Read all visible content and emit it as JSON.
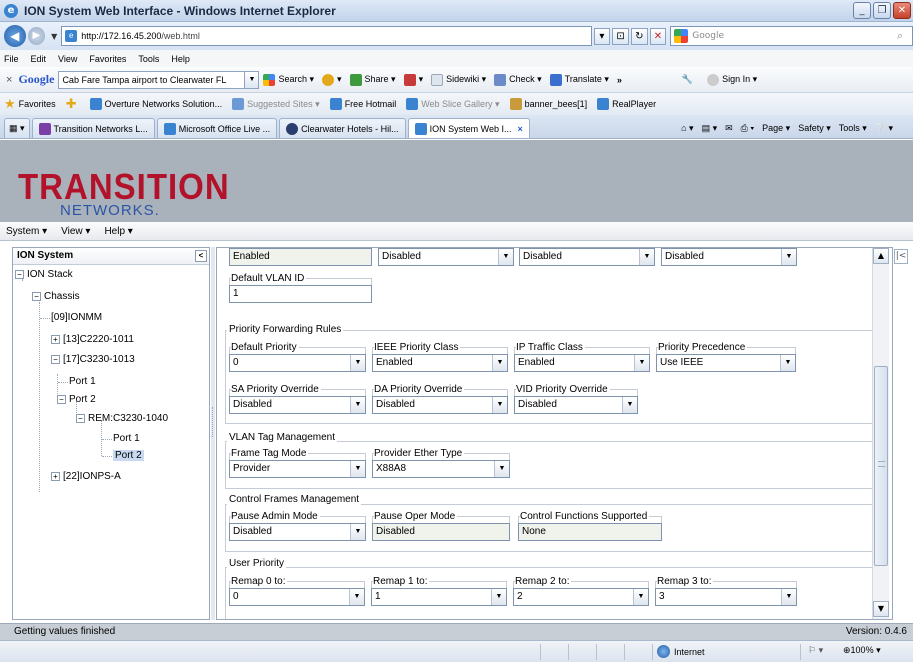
{
  "window": {
    "title": "ION System Web Interface - Windows Internet Explorer"
  },
  "address": {
    "host": "http://172.16.45.200",
    "path": "/web.html",
    "search_placeholder": "Google"
  },
  "menubar": [
    "File",
    "Edit",
    "View",
    "Favorites",
    "Tools",
    "Help"
  ],
  "google_toolbar": {
    "logo": "Google",
    "query": "Cab Fare Tampa airport to Clearwater FL",
    "items": [
      "Search ▾",
      "Share ▾",
      "Sidewiki ▾",
      "Check ▾",
      "Translate ▾",
      "»",
      "Sign In ▾"
    ]
  },
  "favorites": {
    "label": "Favorites",
    "items": [
      "Overture Networks Solution...",
      "Suggested Sites ▾",
      "Free Hotmail",
      "Web Slice Gallery ▾",
      "banner_bees[1]",
      "RealPlayer"
    ]
  },
  "tabs": [
    {
      "label": "Transition Networks L..."
    },
    {
      "label": "Microsoft Office Live ..."
    },
    {
      "label": "Clearwater Hotels - Hil..."
    },
    {
      "label": "ION System Web I...",
      "active": true
    }
  ],
  "commands": [
    "Page ▾",
    "Safety ▾",
    "Tools ▾"
  ],
  "brand": {
    "name": "TRANSITION",
    "sub": "NETWORKS."
  },
  "app_menu": [
    "System ▾",
    "View ▾",
    "Help ▾"
  ],
  "tree": {
    "title": "ION System",
    "nodes": {
      "stack": "ION Stack",
      "chassis": "Chassis",
      "ionmm": "[09]IONMM",
      "c2220": "[13]C2220-1011",
      "c3230": "[17]C3230-1013",
      "port1": "Port 1",
      "port2": "Port 2",
      "rem": "REM:C3230-1040",
      "rem_port1": "Port 1",
      "rem_port2": "Port 2",
      "ionps": "[22]IONPS-A"
    }
  },
  "form": {
    "top_row": [
      "Enabled",
      "Disabled",
      "Disabled",
      "Disabled"
    ],
    "default_vlan": {
      "label": "Default VLAN ID",
      "value": "1"
    },
    "priority_forwarding": {
      "legend": "Priority Forwarding Rules",
      "default_priority": {
        "label": "Default Priority",
        "value": "0"
      },
      "ieee_class": {
        "label": "IEEE Priority Class",
        "value": "Enabled"
      },
      "ip_traffic": {
        "label": "IP Traffic Class",
        "value": "Enabled"
      },
      "precedence": {
        "label": "Priority Precedence",
        "value": "Use IEEE"
      },
      "sa_override": {
        "label": "SA Priority Override",
        "value": "Disabled"
      },
      "da_override": {
        "label": "DA Priority Override",
        "value": "Disabled"
      },
      "vid_override": {
        "label": "VID Priority Override",
        "value": "Disabled"
      }
    },
    "vlan_tag": {
      "legend": "VLAN Tag Management",
      "frame_mode": {
        "label": "Frame Tag Mode",
        "value": "Provider"
      },
      "ether_type": {
        "label": "Provider Ether Type",
        "value": "X88A8"
      }
    },
    "control_frames": {
      "legend": "Control Frames Management",
      "pause_admin": {
        "label": "Pause Admin Mode",
        "value": "Disabled"
      },
      "pause_oper": {
        "label": "Pause Oper Mode",
        "value": "Disabled"
      },
      "control_funcs": {
        "label": "Control Functions Supported",
        "value": "None"
      }
    },
    "user_priority": {
      "legend": "User Priority",
      "remap0": {
        "label": "Remap 0 to:",
        "value": "0"
      },
      "remap1": {
        "label": "Remap 1 to:",
        "value": "1"
      },
      "remap2": {
        "label": "Remap 2 to:",
        "value": "2"
      },
      "remap3": {
        "label": "Remap 3 to:",
        "value": "3"
      }
    }
  },
  "status": {
    "message": "Getting values finished",
    "version": "Version: 0.4.6"
  },
  "ie_status": {
    "zone": "Internet",
    "zoom": "100%"
  }
}
